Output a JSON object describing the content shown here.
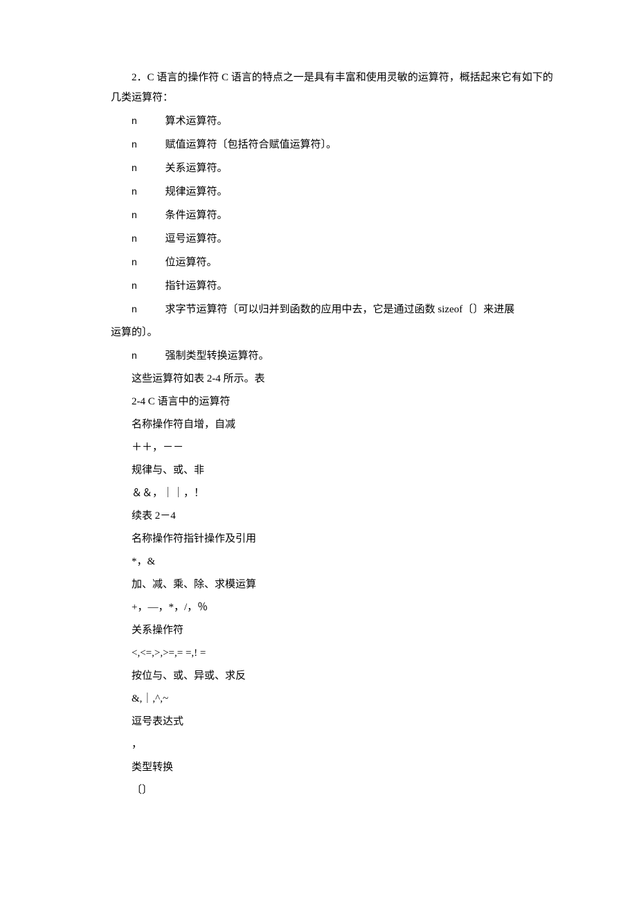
{
  "intro": "2．C 语言的操作符 C 语言的特点之一是具有丰富和使用灵敏的运算符，概括起来它有如下的几类运算符：",
  "bullets": [
    "算术运算符。",
    "赋值运算符〔包括符合赋值运算符〕。",
    "关系运算符。",
    "规律运算符。",
    "条件运算符。",
    "逗号运算符。",
    "位运算符。",
    "指针运算符。",
    "求字节运算符〔可以归并到函数的应用中去，它是通过函数 sizeof〔〕来进展运算的〕。",
    "强制类型转换运算符。"
  ],
  "bullet_marker": "n",
  "bullet9_pre": "求字节运算符〔可以归并到函数的应用中去，它是通过函数 sizeof〔〕来进展",
  "bullet9_suffix": "运算的〕。",
  "lines": [
    "这些运算符如表 2-4 所示。表",
    "2-4 C 语言中的运算符",
    "名称操作符自增，自减",
    "＋＋，－－",
    "规律与、或、非",
    "＆＆，｜｜，！",
    "续表 2－4",
    "名称操作符指针操作及引用",
    "*，&",
    "加、减、乘、除、求模运算",
    "+，―，*，/，％",
    "关系操作符",
    "<,<=,>,>=,= =,! =",
    "按位与、或、异或、求反",
    "&,｜,^,~",
    "逗号表达式",
    "，",
    "类型转换",
    "〔〕"
  ]
}
